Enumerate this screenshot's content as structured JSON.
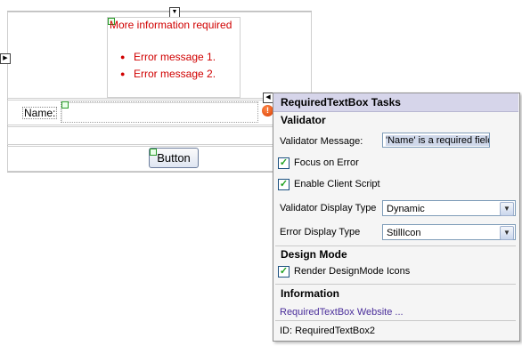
{
  "design_surface": {
    "summary_title": "More information required",
    "errors": [
      "Error message 1.",
      "Error message 2."
    ],
    "name_label": "Name:",
    "button_label": "Button"
  },
  "tasks_panel": {
    "title": "RequiredTextBox Tasks",
    "validator_section": "Validator",
    "validator_message_label": "Validator Message:",
    "validator_message_value": "'Name' is a required field",
    "focus_on_error": {
      "label": "Focus on Error",
      "checked": true
    },
    "enable_client_script": {
      "label": "Enable Client Script",
      "checked": true
    },
    "validator_display_type_label": "Validator Display Type",
    "validator_display_type_value": "Dynamic",
    "error_display_type_label": "Error Display Type",
    "error_display_type_value": "StillIcon",
    "design_mode_section": "Design Mode",
    "render_designmode_icons": {
      "label": "Render DesignMode Icons",
      "checked": true
    },
    "information_section": "Information",
    "website_link": "RequiredTextBox Website ...",
    "id_text": "ID: RequiredTextBox2"
  },
  "colors": {
    "error_red": "#d00000",
    "header_bg": "#d6d5ea",
    "link": "#4a2e9a",
    "check_green": "#21a121"
  },
  "icons": [
    "smart-tag-arrow-icon",
    "error-icon",
    "checkmark-icon",
    "dropdown-arrow-icon"
  ]
}
